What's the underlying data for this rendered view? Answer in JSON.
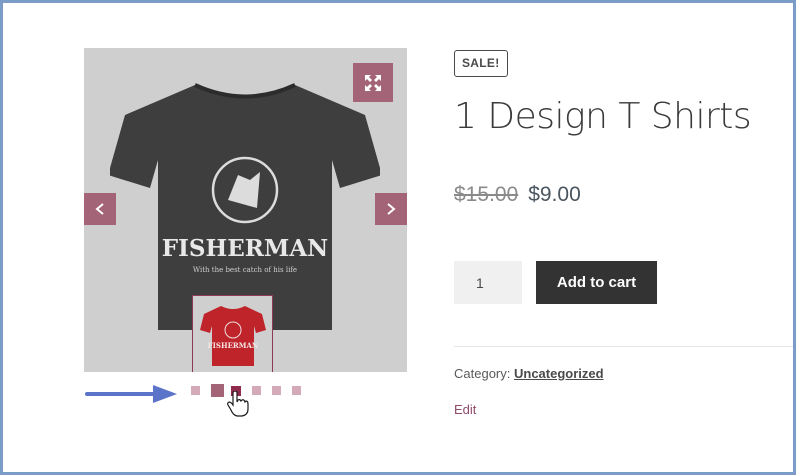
{
  "product": {
    "badge": "SALE!",
    "title": "1 Design T Shirts",
    "price_old": "$15.00",
    "price_new": "$9.00"
  },
  "cart": {
    "quantity": "1",
    "add_label": "Add to cart"
  },
  "meta": {
    "category_label": "Category: ",
    "category_value": "Uncategorized",
    "edit_label": "Edit"
  },
  "gallery": {
    "shirt_brand": "FISHERMAN",
    "shirt_tagline": "With the best catch of his life",
    "thumb_brand": "FISHERMAN",
    "main_shirt_color": "#3e3e3e",
    "thumb_shirt_color": "#c0242b",
    "dots": [
      {
        "state": "normal"
      },
      {
        "state": "active"
      },
      {
        "state": "hover"
      },
      {
        "state": "normal"
      },
      {
        "state": "normal"
      },
      {
        "state": "normal"
      }
    ]
  },
  "colors": {
    "accent": "#a46477",
    "button_dark": "#333333",
    "annotation_arrow": "#5b73c8"
  }
}
